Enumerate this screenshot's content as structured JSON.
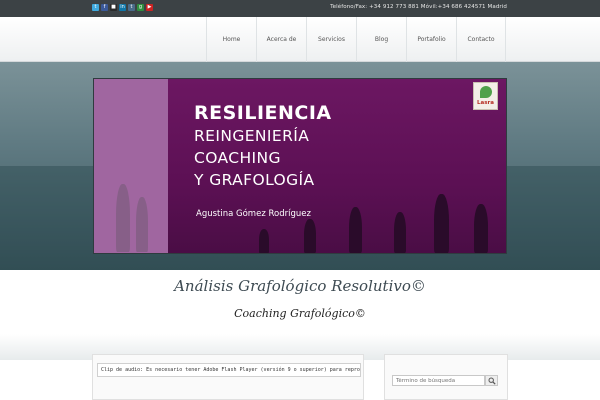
{
  "topbar": {
    "social_icons": [
      {
        "name": "twitter-icon",
        "color": "#3fa9dd"
      },
      {
        "name": "facebook-icon",
        "color": "#3b5998"
      },
      {
        "name": "delicious-icon",
        "color": "#2a2a2a"
      },
      {
        "name": "linkedin-icon",
        "color": "#0e76a8"
      },
      {
        "name": "tumblr-icon",
        "color": "#4a6b8a"
      },
      {
        "name": "google-icon",
        "color": "#2f8f3f"
      },
      {
        "name": "youtube-icon",
        "color": "#cc2222"
      }
    ],
    "contact": "Teléfono/Fax: +34 912 773 881 Móvil:+34 686 424571 Madrid"
  },
  "nav": {
    "items": [
      "Home",
      "Acerca de",
      "Servicios",
      "Blog",
      "Portafolio",
      "Contacto"
    ]
  },
  "hero": {
    "line1": "RESILIENCIA",
    "line2": "REINGENIERÍA",
    "line3": "COACHING",
    "line4": "Y GRAFOLOGÍA",
    "author": "Agustina Gómez Rodríguez",
    "logo_text": "Lasra"
  },
  "headings": {
    "main": "Análisis Grafológico Resolutivo©",
    "sub": "Coaching Grafológico©"
  },
  "content": {
    "notice": "Clip de audio: Es necesario tener Adobe Flash Player (versión 9 o superior) para reproducir"
  },
  "sidebar": {
    "search_placeholder": "Término de búsqueda"
  },
  "colors": {
    "topbar": "#3c4245",
    "slide_purple": "#6c1762",
    "slide_lilac": "#a066a0"
  }
}
